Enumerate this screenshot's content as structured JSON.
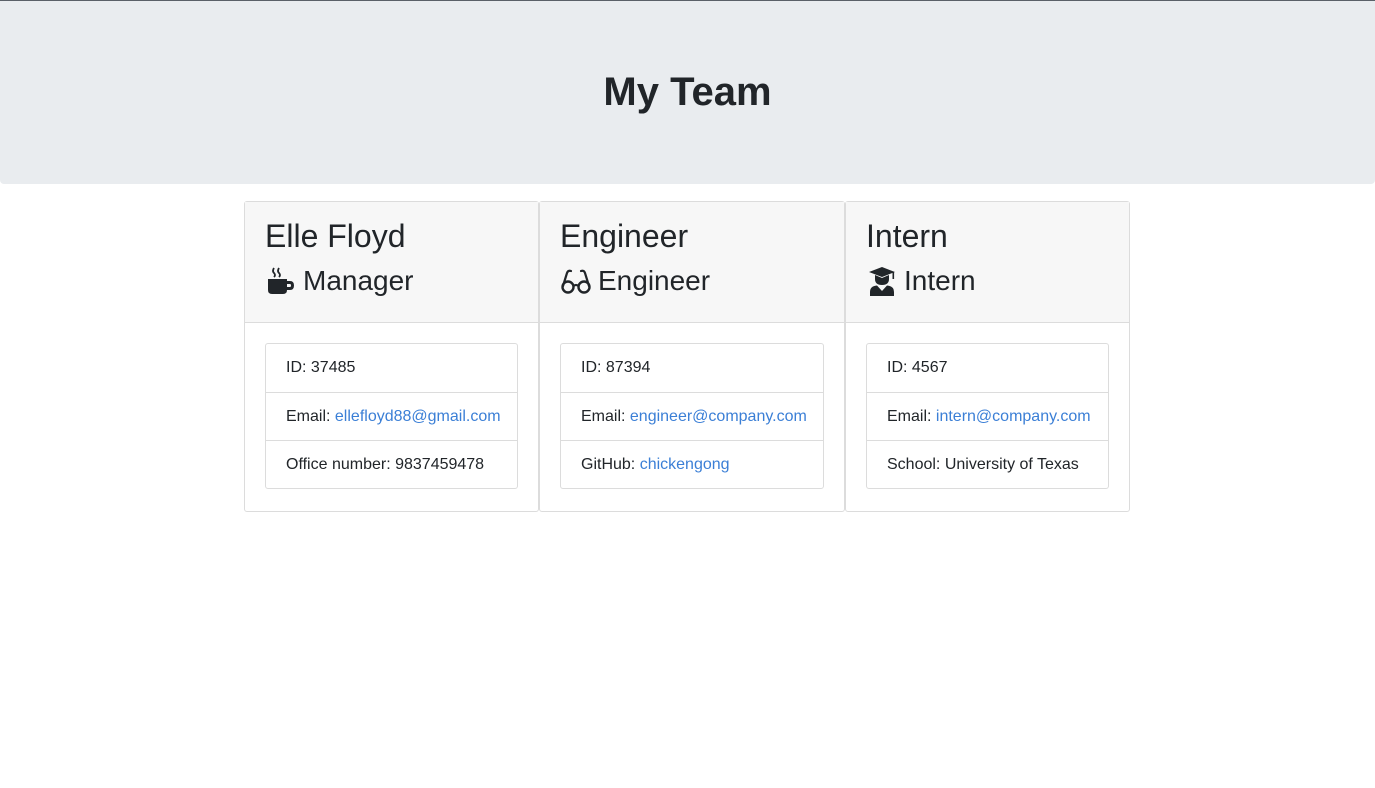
{
  "header": {
    "title": "My Team"
  },
  "cards": [
    {
      "name": "Elle Floyd",
      "role": "Manager",
      "role_icon": "coffee-mug-icon",
      "id_label": "ID:",
      "id_value": "37485",
      "email_label": "Email:",
      "email_value": "ellefloyd88@gmail.com",
      "extra_label": "Office number:",
      "extra_value": "9837459478"
    },
    {
      "name": "Engineer",
      "role": "Engineer",
      "role_icon": "glasses-icon",
      "id_label": "ID:",
      "id_value": "87394",
      "email_label": "Email:",
      "email_value": "engineer@company.com",
      "extra_label": "GitHub:",
      "extra_value": "chickengong"
    },
    {
      "name": "Intern",
      "role": "Intern",
      "role_icon": "graduate-icon",
      "id_label": "ID:",
      "id_value": "4567",
      "email_label": "Email:",
      "email_value": "intern@company.com",
      "extra_label": "School:",
      "extra_value": "University of Texas"
    }
  ],
  "colors": {
    "header_bg": "#e9ecef",
    "link": "#3b7fd6",
    "text": "#212529"
  }
}
